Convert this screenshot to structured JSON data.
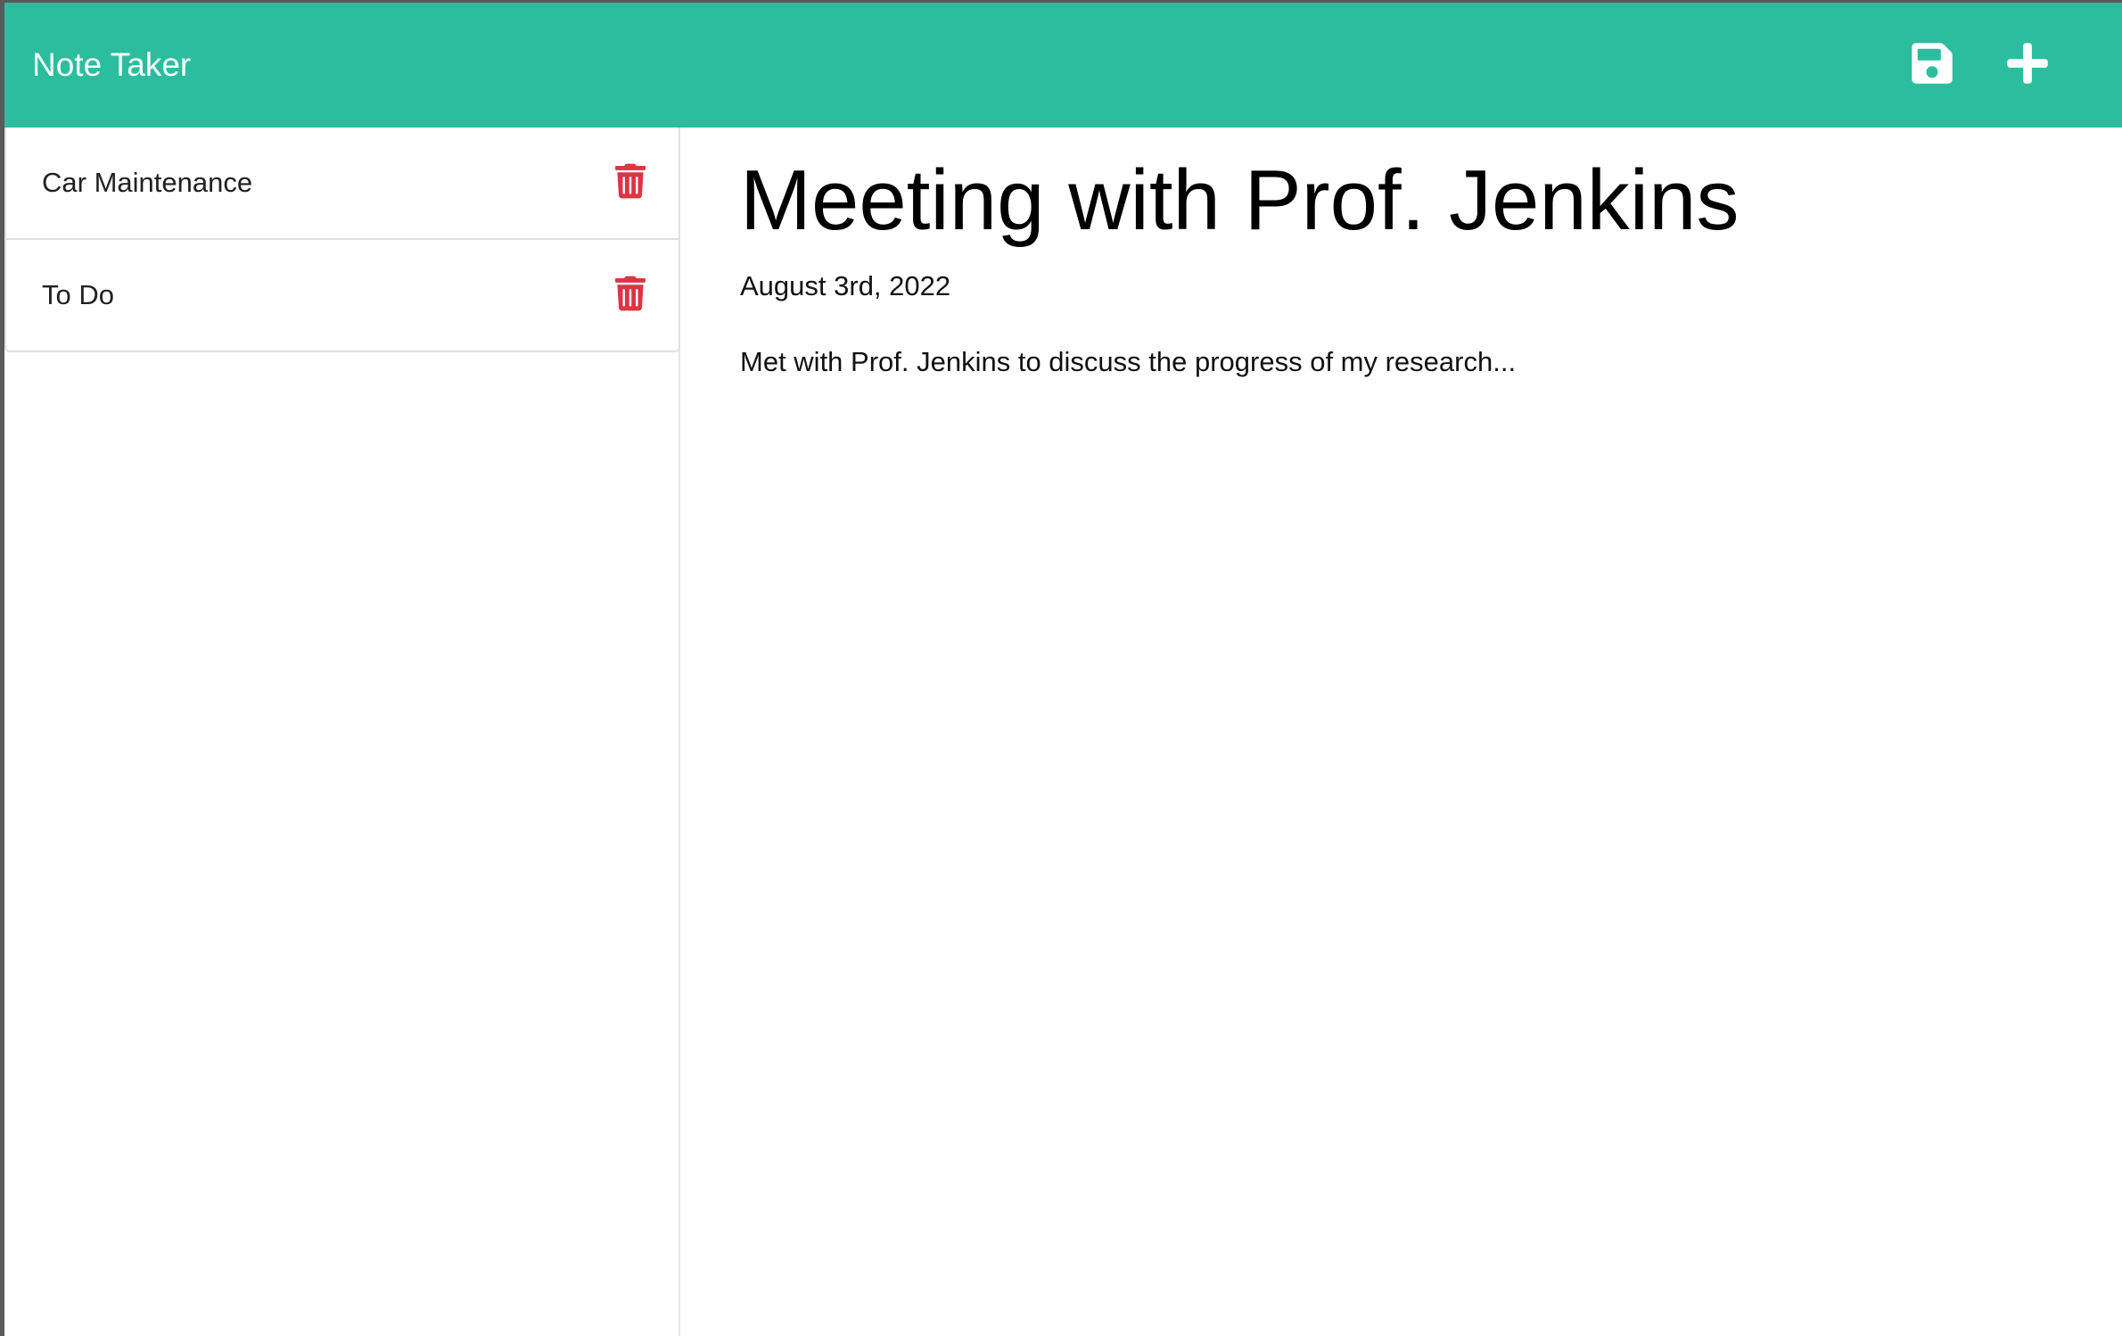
{
  "app": {
    "brand": "Note Taker"
  },
  "toolbar": {
    "save_icon": "save-icon",
    "new_icon": "plus-icon"
  },
  "notes": [
    {
      "title": "Car Maintenance",
      "delete_icon": "trash-icon"
    },
    {
      "title": "To Do",
      "delete_icon": "trash-icon"
    }
  ],
  "active_note": {
    "title": "Meeting with Prof. Jenkins",
    "date": "August 3rd, 2022",
    "body": "Met with Prof. Jenkins to discuss the progress of my research..."
  },
  "colors": {
    "navbar": "#2bbd9e",
    "delete_icon": "#dc3545",
    "nav_icon": "#ffffff"
  }
}
